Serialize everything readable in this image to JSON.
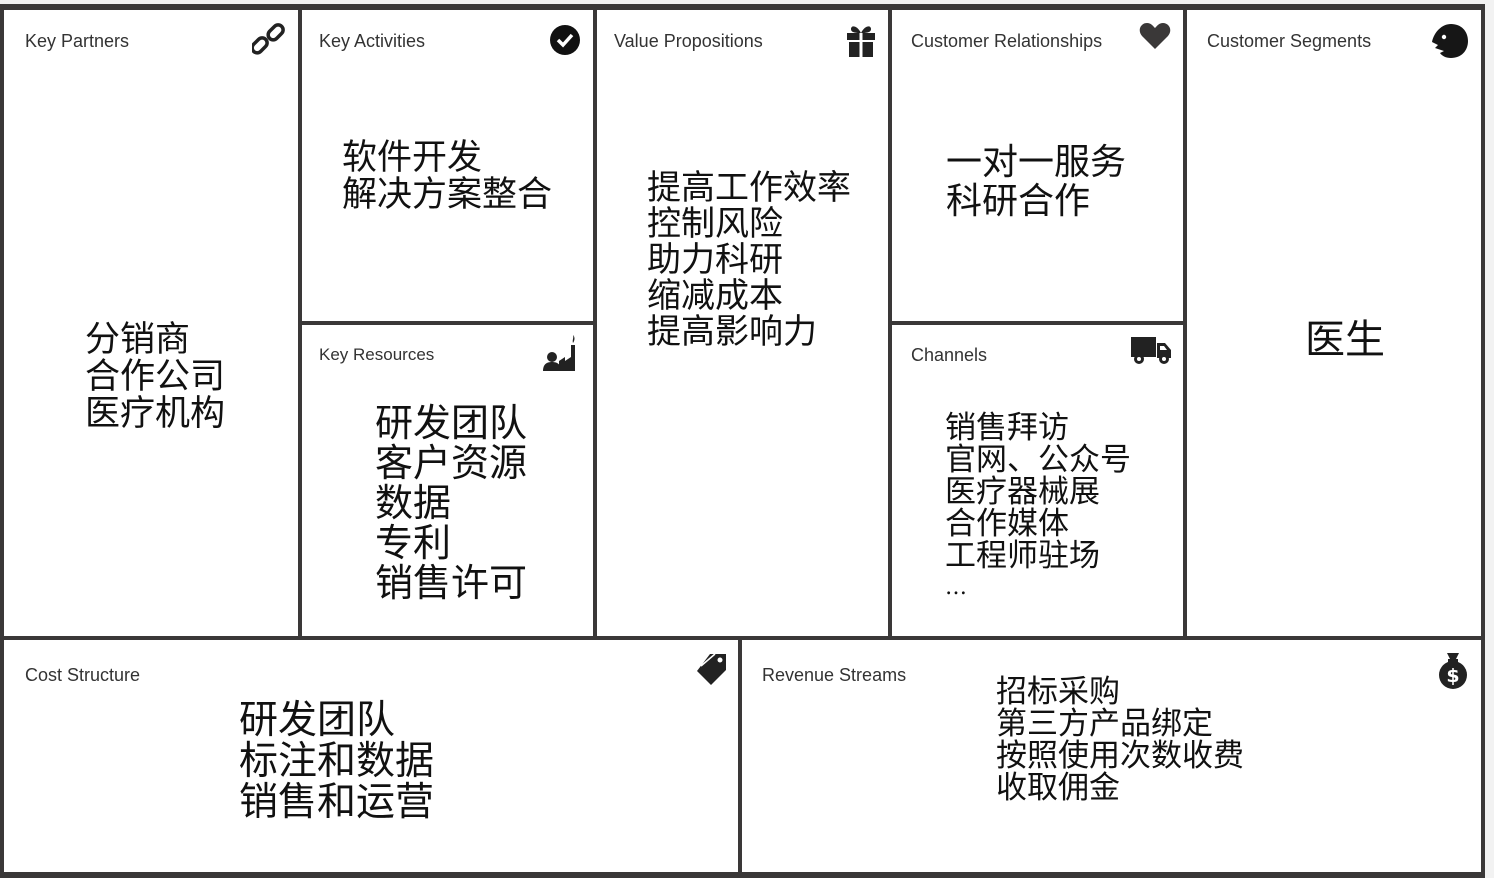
{
  "canvas": {
    "key_partners": {
      "title": "Key Partners",
      "icon": "link-icon",
      "items": [
        "分销商",
        "合作公司",
        "医疗机构"
      ]
    },
    "key_activities": {
      "title": "Key Activities",
      "icon": "checkmark-circle-icon",
      "items": [
        "软件开发",
        "解决方案整合"
      ]
    },
    "key_resources": {
      "title": "Key Resources",
      "icon": "factory-worker-icon",
      "items": [
        "研发团队",
        "客户资源",
        "数据",
        "专利",
        "销售许可"
      ]
    },
    "value_propositions": {
      "title": "Value Propositions",
      "icon": "gift-icon",
      "items": [
        "提高工作效率",
        "控制风险",
        "助力科研",
        "缩减成本",
        "提高影响力"
      ]
    },
    "customer_relationships": {
      "title": "Customer Relationships",
      "icon": "heart-icon",
      "items": [
        "一对一服务",
        "科研合作"
      ]
    },
    "channels": {
      "title": "Channels",
      "icon": "truck-icon",
      "items": [
        "销售拜访",
        "官网、公众号",
        "医疗器械展",
        "合作媒体",
        "工程师驻场",
        "…"
      ]
    },
    "customer_segments": {
      "title": "Customer Segments",
      "icon": "face-icon",
      "items": [
        "医生"
      ]
    },
    "cost_structure": {
      "title": "Cost Structure",
      "icon": "price-tag-icon",
      "items": [
        "研发团队",
        "标注和数据",
        "销售和运营"
      ]
    },
    "revenue_streams": {
      "title": "Revenue Streams",
      "icon": "money-bag-icon",
      "items": [
        "招标采购",
        "第三方产品绑定",
        "按照使用次数收费",
        "收取佣金"
      ]
    }
  }
}
